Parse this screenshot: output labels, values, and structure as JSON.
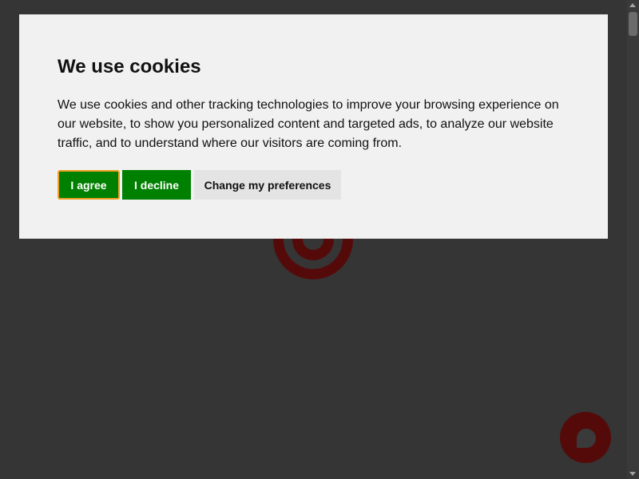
{
  "cookie_dialog": {
    "title": "We use cookies",
    "body": "We use cookies and other tracking technologies to improve your browsing experience on our website, to show you personalized content and targeted ads, to analyze our website traffic, and to understand where our visitors are coming from.",
    "buttons": {
      "agree": "I agree",
      "decline": "I decline",
      "preferences": "Change my preferences"
    }
  },
  "colors": {
    "overlay_background": "#353535",
    "dialog_background": "#f1f1f1",
    "primary_button": "#008000",
    "focus_outline": "#f0a020",
    "secondary_button": "#e4e4e4",
    "brand_dimmed": "#550a0a"
  },
  "icons": {
    "background_logo": "target-logo-icon",
    "chat": "chat-bubble-icon"
  }
}
